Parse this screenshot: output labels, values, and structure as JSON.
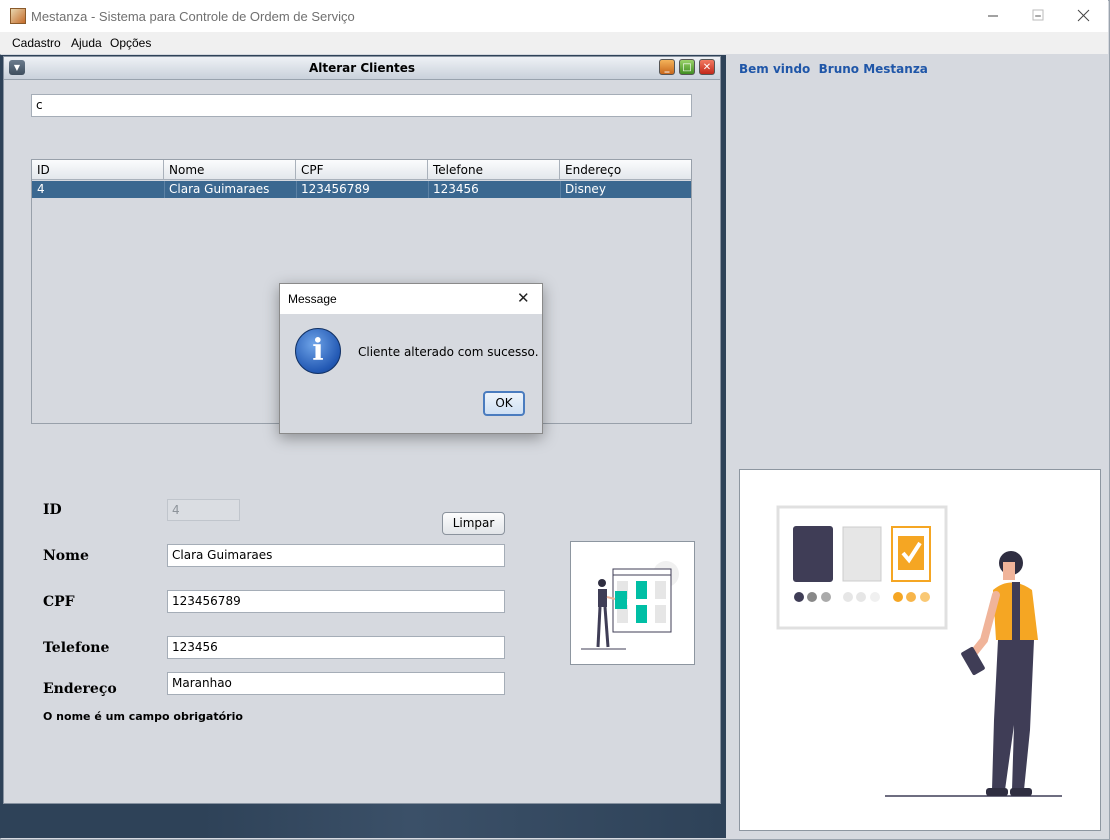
{
  "window": {
    "title": "Mestanza - Sistema para Controle de Ordem de Serviço",
    "minimize_icon": "minimize-icon",
    "maximize_icon": "maximize-icon",
    "close_icon": "close-icon"
  },
  "menubar": {
    "items": [
      "Cadastro",
      "Ajuda",
      "Opções"
    ]
  },
  "welcome": {
    "prefix": "Bem vindo",
    "user": "Bruno Mestanza"
  },
  "internal_frame": {
    "title": "Alterar Clientes",
    "search": {
      "value": "c"
    },
    "table": {
      "columns": [
        "ID",
        "Nome",
        "CPF",
        "Telefone",
        "Endereço"
      ],
      "rows": [
        {
          "id": "4",
          "nome": "Clara Guimaraes",
          "cpf": "123456789",
          "telefone": "123456",
          "endereco": "Disney"
        }
      ]
    },
    "form": {
      "id_label": "ID",
      "id_value": "4",
      "nome_label": "Nome",
      "nome_value": "Clara Guimaraes",
      "cpf_label": "CPF",
      "cpf_value": "123456789",
      "telefone_label": "Telefone",
      "telefone_value": "123456",
      "endereco_label": "Endereço",
      "endereco_value": "Maranhao",
      "limpar_label": "Limpar",
      "hint": "O nome é um campo obrigatório"
    }
  },
  "dialog": {
    "title": "Message",
    "message": "Cliente alterado com sucesso.",
    "ok_label": "OK",
    "icon": "info-icon",
    "close_glyph": "✕"
  },
  "colors": {
    "accent_blue": "#1f56a8",
    "selected_row": "#3b6890",
    "desktop": "#2e4258",
    "illus_orange": "#f5a623",
    "illus_teal": "#00bfa5",
    "illus_dark": "#3f3d56"
  }
}
